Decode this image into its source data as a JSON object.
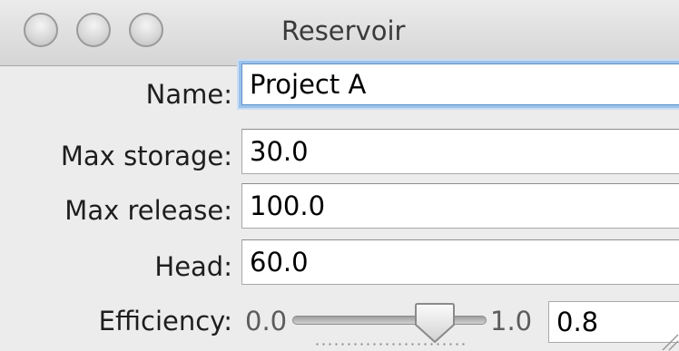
{
  "window": {
    "title": "Reservoir"
  },
  "form": {
    "name_label": "Name:",
    "name_value": "Project A",
    "max_storage_label": "Max storage:",
    "max_storage_value": "30.0",
    "max_release_label": "Max release:",
    "max_release_value": "100.0",
    "head_label": "Head:",
    "head_value": "60.0",
    "efficiency_label": "Efficiency:",
    "efficiency_min": "0.0",
    "efficiency_max": "1.0",
    "efficiency_value": "0.8",
    "efficiency_level": 0.8
  },
  "icons": {
    "close": "traffic-light-close-icon",
    "minimize": "traffic-light-minimize-icon",
    "zoom": "traffic-light-zoom-icon",
    "slider_knob": "slider-knob-icon",
    "resize": "resize-grip-icon"
  },
  "colors": {
    "focus_ring": "#9ac1ea",
    "window_bg": "#ececec"
  }
}
